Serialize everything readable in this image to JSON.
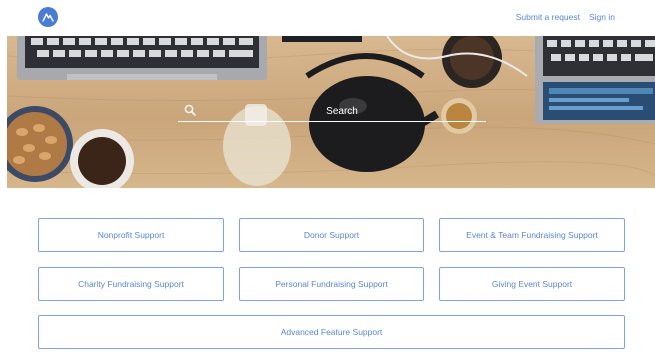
{
  "header": {
    "logo_icon": "mountain-logo-icon",
    "nav": {
      "submit_request": "Submit a request",
      "sign_in": "Sign in"
    }
  },
  "hero": {
    "search": {
      "placeholder": "Search",
      "icon": "search-icon"
    }
  },
  "categories": [
    {
      "label": "Nonprofit Support"
    },
    {
      "label": "Donor Support"
    },
    {
      "label": "Event & Team Fundraising Support"
    },
    {
      "label": "Charity Fundraising Support"
    },
    {
      "label": "Personal Fundraising Support"
    },
    {
      "label": "Giving Event Support"
    },
    {
      "label": "Advanced Feature Support"
    }
  ],
  "colors": {
    "accent": "#4a7bd6",
    "link": "#5b86d6",
    "card_border": "#7fa3e0"
  }
}
